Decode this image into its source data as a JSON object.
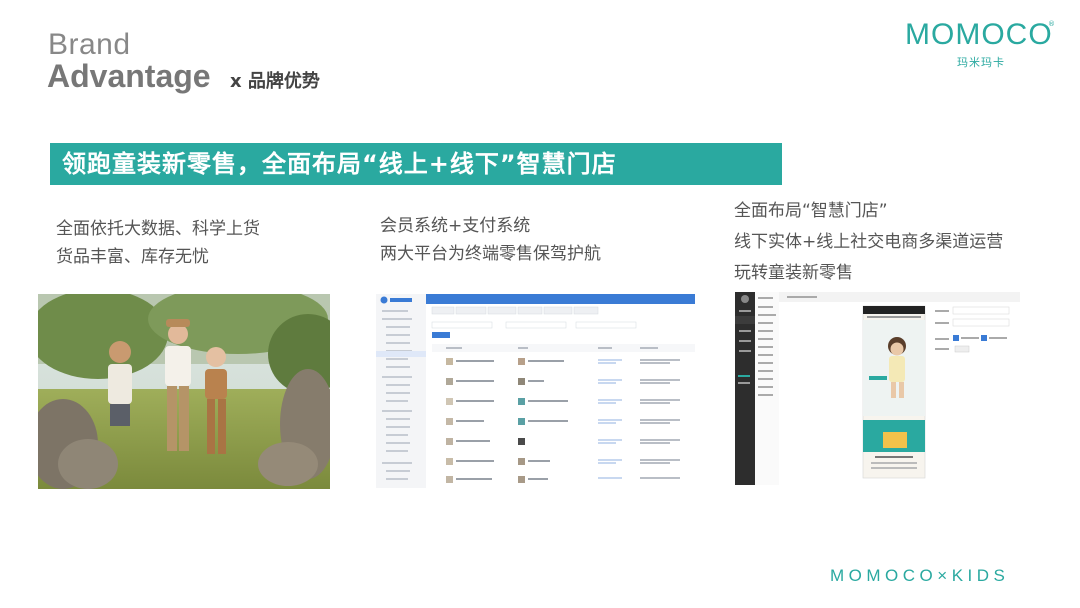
{
  "header": {
    "title_line1": "Brand",
    "title_line2": "Advantage",
    "subtitle": "x 品牌优势"
  },
  "logo": {
    "wordmark": "MOMOCO",
    "registered": "®",
    "chinese": "玛米玛卡"
  },
  "banner": {
    "text": "领跑童装新零售，全面布局“线上+线下”智慧门店"
  },
  "columns": [
    {
      "lines": [
        "全面依托大数据、科学上货",
        "货品丰富、库存无忧"
      ]
    },
    {
      "lines": [
        "会员系统+支付系统",
        "两大平台为终端零售保驾护航"
      ]
    },
    {
      "lines": [
        "全面布局“智慧门店”",
        "线下实体+线上社交电商多渠道运营",
        "玩转童装新零售"
      ]
    }
  ],
  "footer": {
    "text": "MOMOCO×KIDS"
  },
  "colors": {
    "accent": "#2aa9a0",
    "admin_blue": "#3a7bd5",
    "sidebar_dark": "#2d2d2d"
  }
}
